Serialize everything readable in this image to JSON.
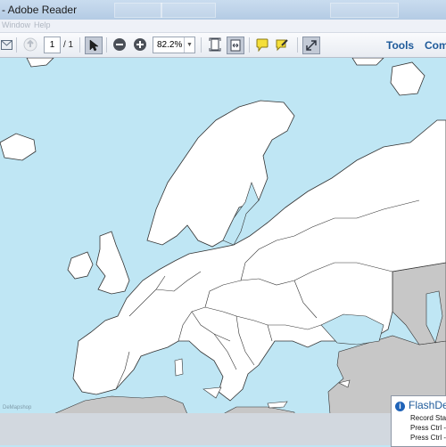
{
  "window": {
    "title": "- Adobe Reader"
  },
  "menu": {
    "items": [
      "Window",
      "Help"
    ]
  },
  "toolbar": {
    "page_current": "1",
    "page_total": "/ 1",
    "zoom": "82.2%",
    "tools_label": "Tools",
    "comment_label": "Com"
  },
  "map": {
    "watermark": "DeMapshop",
    "colors": {
      "sea": "#bfe6f4",
      "land": "#ffffff",
      "outside_land": "#c7c7c7",
      "border": "#333333"
    }
  },
  "popup": {
    "app_name": "FlashDen",
    "lines": [
      "Record Star",
      "Press Ctrl -",
      "Press Ctrl -"
    ]
  },
  "icons": [
    "email-icon",
    "prev-page-icon",
    "select-tool-icon",
    "zoom-out-icon",
    "zoom-in-icon",
    "fit-page-icon",
    "fit-width-icon",
    "sticky-note-icon",
    "highlight-icon",
    "expand-icon",
    "info-icon"
  ]
}
